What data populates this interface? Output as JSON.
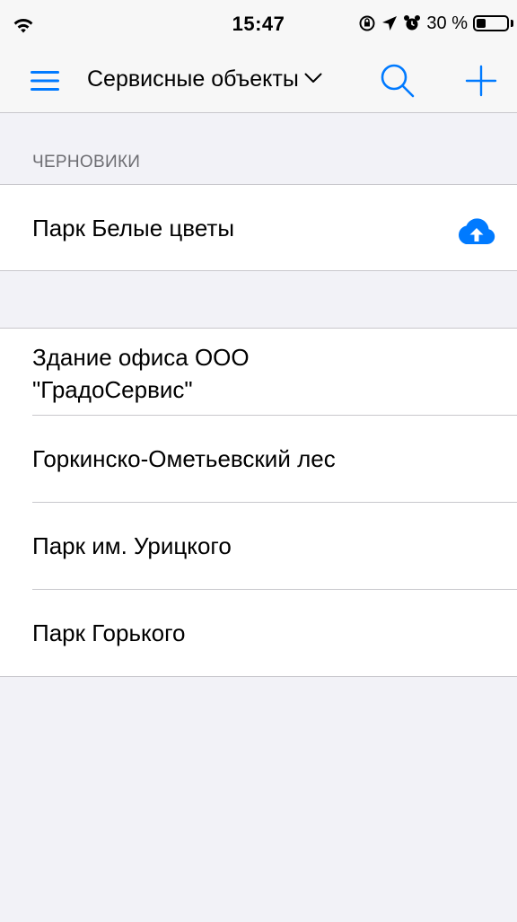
{
  "status_bar": {
    "time": "15:47",
    "battery": "30 %",
    "battery_level": 0.3,
    "icons": [
      "wifi-icon",
      "orientation-lock-icon",
      "location-arrow-icon",
      "alarm-icon",
      "battery-icon"
    ]
  },
  "nav": {
    "title": "Сервисные объекты",
    "icons": [
      "menu-icon",
      "chevron-down-icon",
      "search-icon",
      "plus-icon"
    ]
  },
  "drafts": {
    "header": "ЧЕРНОВИКИ",
    "items": [
      {
        "label": "Парк Белые цветы",
        "icon": "cloud-upload-icon"
      }
    ]
  },
  "objects": {
    "items": [
      {
        "label": "Здание офиса ООО \"ГрадоСервис\""
      },
      {
        "label": "Горкинско-Ометьевский лес"
      },
      {
        "label": "Парк им. Урицкого"
      },
      {
        "label": "Парк Горького"
      }
    ]
  },
  "colors": {
    "accent": "#007aff",
    "background": "#f2f2f7",
    "separator": "#c8c7cc",
    "section_text": "#6d6d72"
  }
}
